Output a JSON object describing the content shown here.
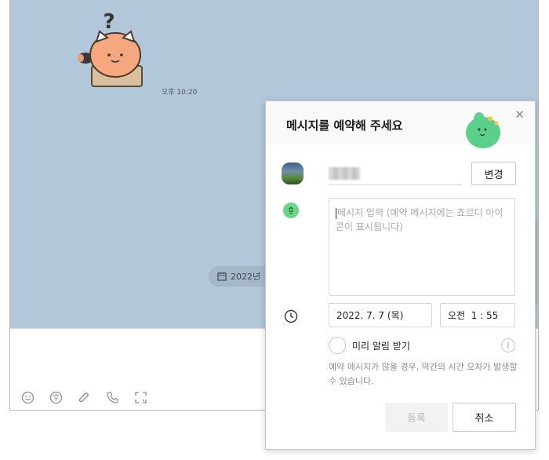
{
  "chat": {
    "message_time": "오후 10:20",
    "date_pill": "2022년"
  },
  "toolbar": {
    "icons": [
      "emoticon-icon",
      "sticker-icon",
      "attachment-icon",
      "call-icon",
      "capture-icon"
    ]
  },
  "dialog": {
    "title": "메시지를 예약해 주세요",
    "close_label": "✕",
    "change_button": "변경",
    "message_placeholder": "메시지 입력 (예약 메시지에는 죠르디 아이콘이 표시됩니다)",
    "date_value": "2022. 7. 7 (목)",
    "time_value": "오전  1 : 55",
    "remind_label": "미리 알림 받기",
    "info_label": "i",
    "notice": "예약 메시지가 많을 경우, 약간의 시간 오차가 발생할 수 있습니다.",
    "register_button": "등록",
    "cancel_button": "취소"
  },
  "colors": {
    "chat_background": "#b2c7d9",
    "emoji_green": "#67d783",
    "disabled_button": "#f2f2f2"
  }
}
